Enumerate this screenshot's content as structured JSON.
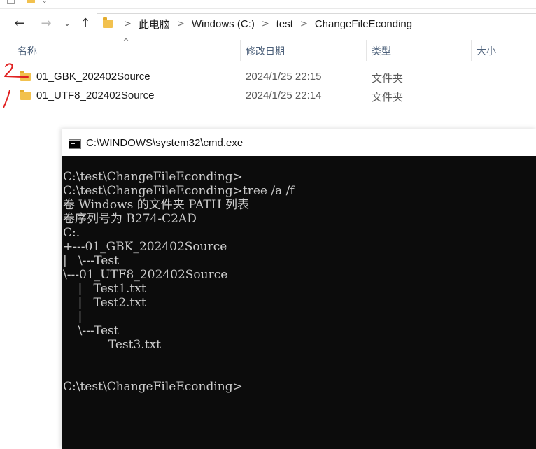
{
  "explorer": {
    "breadcrumb": [
      "此电脑",
      "Windows (C:)",
      "test",
      "ChangeFileEconding"
    ],
    "columns": {
      "name": "名称",
      "date": "修改日期",
      "type": "类型",
      "size": "大小"
    },
    "sort_indicator": "^",
    "rows": [
      {
        "name": "01_GBK_202402Source",
        "date": "2024/1/25 22:15",
        "type": "文件夹"
      },
      {
        "name": "01_UTF8_202402Source",
        "date": "2024/1/25 22:14",
        "type": "文件夹"
      }
    ],
    "icons": {
      "back": "arrow-left-icon",
      "forward": "arrow-right-icon",
      "recent": "chevron-down-icon",
      "up": "arrow-up-icon",
      "folder": "folder-icon"
    }
  },
  "cmd": {
    "title": "C:\\WINDOWS\\system32\\cmd.exe",
    "lines": [
      "C:\\test\\ChangeFileEconding>",
      "C:\\test\\ChangeFileEconding>tree /a /f",
      "卷 Windows 的文件夹 PATH 列表",
      "卷序列号为 B274-C2AD",
      "C:.",
      "+---01_GBK_202402Source",
      "|   \\---Test",
      "\\---01_UTF8_202402Source",
      "    |   Test1.txt",
      "    |   Test2.txt",
      "    |",
      "    \\---Test",
      "            Test3.txt",
      "",
      "",
      "C:\\test\\ChangeFileEconding>"
    ]
  },
  "colors": {
    "folder": "#f2c14e",
    "header_text": "#4c607a",
    "cmd_background": "#0c0c0c",
    "cmd_text": "#cccccc",
    "annotation": "#e02020"
  }
}
